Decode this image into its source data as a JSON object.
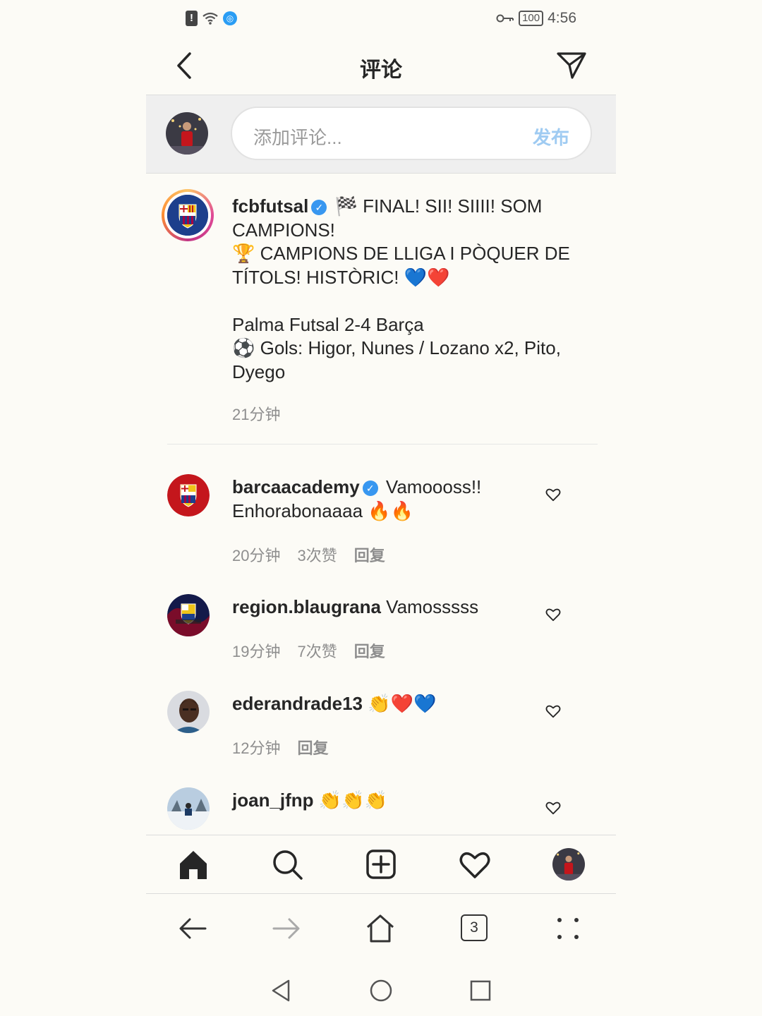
{
  "status_bar": {
    "time": "4:56",
    "battery": "100"
  },
  "header": {
    "title": "评论"
  },
  "comment_input": {
    "placeholder": "添加评论...",
    "post_label": "发布"
  },
  "caption": {
    "username": "fcbfutsal",
    "verified": true,
    "line1": "🏁 FINAL! SII! SIIII! SOM CAMPIONS!",
    "line2": "🏆 CAMPIONS DE LLIGA I PÒQUER DE TÍTOLS! HISTÒRIC! 💙❤️",
    "line3": "Palma Futsal 2-4 Barça",
    "line4": "⚽ Gols: Higor, Nunes / Lozano x2, Pito, Dyego",
    "time": "21分钟"
  },
  "comments": [
    {
      "username": "barcaacademy",
      "verified": true,
      "text": "Vamoooss!! Enhorabonaaaa 🔥🔥",
      "time": "20分钟",
      "likes": "3次赞",
      "reply": "回复"
    },
    {
      "username": "region.blaugrana",
      "verified": false,
      "text": "Vamosssss",
      "time": "19分钟",
      "likes": "7次赞",
      "reply": "回复"
    },
    {
      "username": "ederandrade13",
      "verified": false,
      "text": "👏❤️💙",
      "time": "12分钟",
      "likes": "",
      "reply": "回复"
    },
    {
      "username": "joan_jfnp",
      "verified": false,
      "text": "👏👏👏",
      "time": "",
      "likes": "",
      "reply": ""
    }
  ],
  "browser_nav": {
    "tab_count": "3"
  },
  "colors": {
    "accent_blue": "#3897f0",
    "post_disabled": "#9fcbf2",
    "meta_gray": "#8e8e8e"
  }
}
